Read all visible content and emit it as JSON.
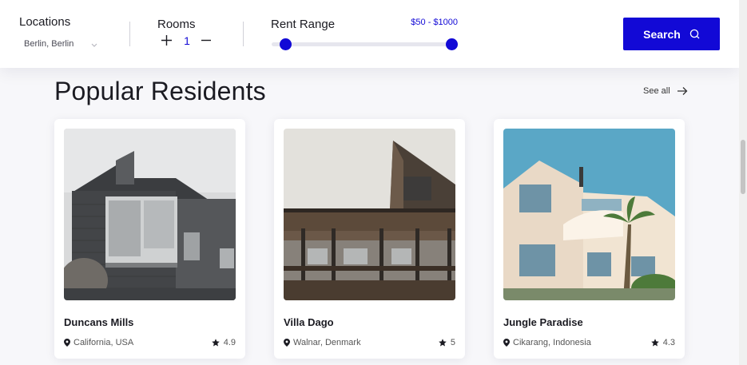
{
  "search": {
    "locations_label": "Locations",
    "location_value": "Berlin, Berlin",
    "rooms_label": "Rooms",
    "rooms_count": "1",
    "rent_label": "Rent Range",
    "rent_value": "$50 - $1000",
    "rent_range_fraction": [
      0,
      1
    ],
    "search_button_label": "Search"
  },
  "section": {
    "title": "Popular Residents",
    "see_all_label": "See all"
  },
  "residents": [
    {
      "name": "Duncans Mills",
      "location": "California, USA",
      "rating": "4.9"
    },
    {
      "name": "Villa Dago",
      "location": "Walnar, Denmark",
      "rating": "5"
    },
    {
      "name": "Jungle Paradise",
      "location": "Cikarang, Indonesia",
      "rating": "4.3"
    }
  ],
  "colors": {
    "accent": "#1209d6",
    "background": "#f7f7fa",
    "card": "#ffffff"
  },
  "icons": [
    "chevron-down-icon",
    "plus-icon",
    "minus-icon",
    "search-icon",
    "arrow-right-icon",
    "location-pin-icon",
    "star-icon"
  ]
}
